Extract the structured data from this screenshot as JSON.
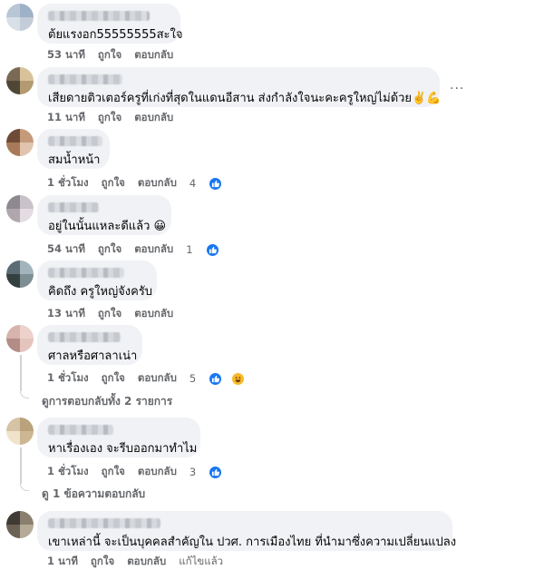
{
  "labels": {
    "like": "ถูกใจ",
    "reply": "ตอบกลับ",
    "edit": "แก้ไขแล้ว"
  },
  "comments": [
    {
      "text": "ต้ยแรงอก55555555สะใจ",
      "time": "53 นาที"
    },
    {
      "text": "เสียดายติวเตอร์ครูที่เก่งที่สุดในแดนอีสาน ส่งกำลังใจนะคะครูใหญ่ไม่ด้วย✌️💪",
      "time": "11 นาที"
    },
    {
      "text": "สมน้ำหน้า",
      "time": "1 ชั่วโมง",
      "reactions": "4"
    },
    {
      "text": "อยู่ในนั้นแหละดีแล้ว 😀",
      "time": "54 นาที",
      "reactions": "1"
    },
    {
      "text": "คิดถึง ครูใหญ่จังครับ",
      "time": "13 นาที"
    },
    {
      "text": "ศาลหรือศาลาเน่า",
      "time": "1 ชั่วโมง",
      "reactions": "5",
      "replies": "ดูการตอบกลับทั้ง 2 รายการ"
    },
    {
      "text": "หาเรื่องเอง จะรีบออกมาทำไม",
      "time": "1 ชั่วโมง",
      "reactions": "3",
      "replies": "ดู 1 ข้อความตอบกลับ"
    },
    {
      "text": "เขาเหล่านี้ จะเป็นบุคคลสำคัญใน ปวศ. การเมืองไทย ที่นำมาซึ่งความเปลี่ยนแปลง",
      "time": "1 นาที"
    }
  ],
  "more_options": "...",
  "icons": {
    "like": "thumbs-up-icon",
    "haha": "haha-face-icon"
  },
  "colors": {
    "bubble": "#f0f2f5",
    "like": "#1877f2",
    "meta_text": "#65676b"
  }
}
